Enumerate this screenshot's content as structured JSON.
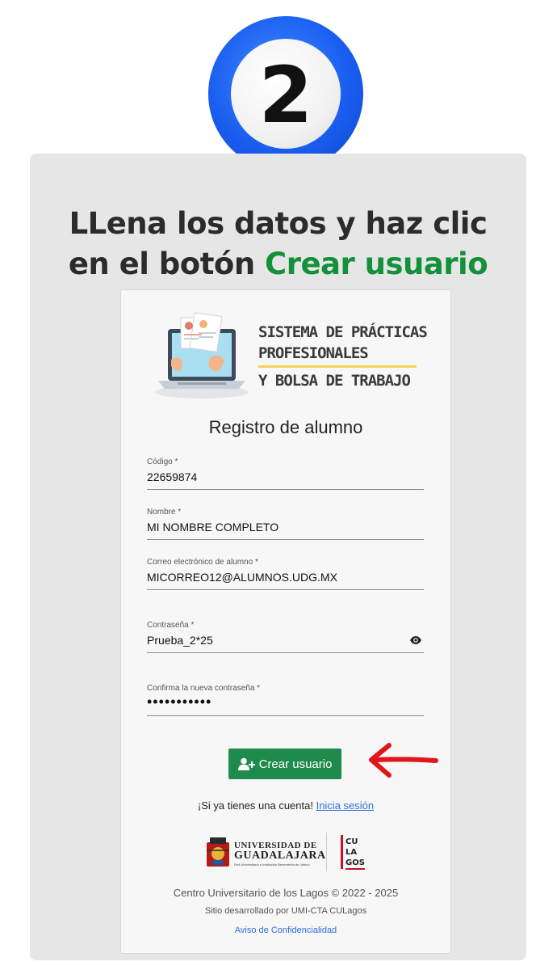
{
  "step": {
    "number": "2"
  },
  "headline": {
    "line1": "LLena los datos y haz clic",
    "line2_prefix": "en el botón ",
    "line2_highlight": "Crear usuario"
  },
  "colors": {
    "accent_green": "#12913a",
    "button_green": "#1e8a4c",
    "badge_blue": "#1a5ef0",
    "arrow_red": "#e0161c",
    "link_blue": "#2d6fd8"
  },
  "logo": {
    "line1": "SISTEMA DE PRÁCTICAS",
    "line2": "PROFESIONALES",
    "line3": "Y BOLSA DE TRABAJO"
  },
  "form": {
    "title": "Registro de alumno",
    "fields": [
      {
        "label": "Código *",
        "value": "22659874"
      },
      {
        "label": "Nombre *",
        "value": "MI NOMBRE COMPLETO"
      },
      {
        "label": "Correo electrónico de alumno *",
        "value": "MICORREO12@ALUMNOS.UDG.MX"
      },
      {
        "label": "Contraseña *",
        "value": "Prueba_2*25"
      },
      {
        "label": "Confirma la nueva contraseña *",
        "value": "•••••••••••"
      }
    ],
    "submit_label": "Crear usuario",
    "submit_icon": "add-user-icon",
    "password_toggle_icon": "eye-icon"
  },
  "login": {
    "prompt": "¡Si ya tienes una cuenta! ",
    "link": "Inicia sesión"
  },
  "institution": {
    "name_line1": "UNIVERSIDAD DE",
    "name_line2": "GUADALAJARA",
    "tagline": "Red Universitaria e Institución Benemérita de Jalisco",
    "campus_logo": [
      "CU",
      "LA",
      "GOS"
    ]
  },
  "footer": {
    "copyright": "Centro Universitario de los Lagos © 2022 - 2025",
    "developer": "Sitio desarrollado por UMI-CTA CULagos",
    "privacy_link": "Aviso de Confidencialidad"
  }
}
